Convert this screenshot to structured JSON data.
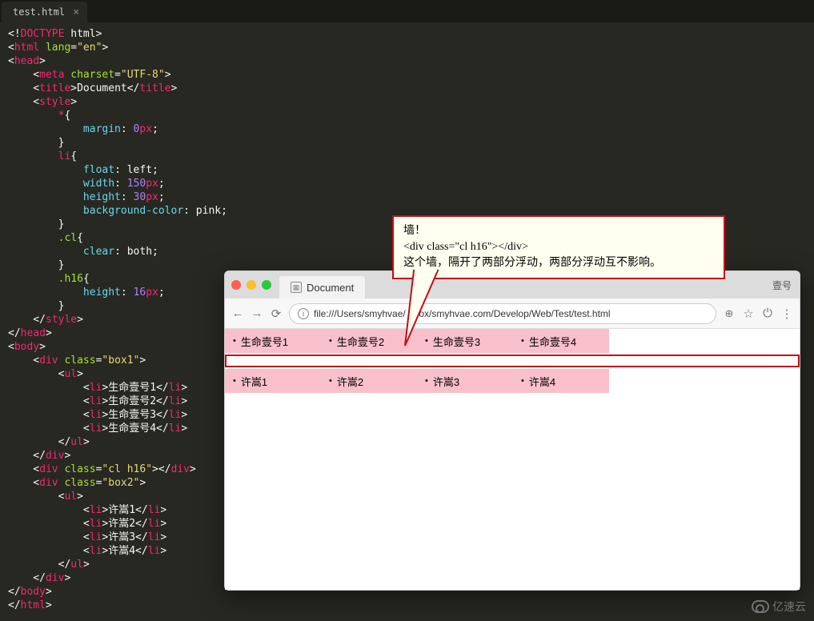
{
  "editor": {
    "tab_name": "test.html",
    "code_lines": [
      [
        {
          "c": "p",
          "t": "<!"
        },
        {
          "c": "r",
          "t": "DOCTYPE"
        },
        {
          "c": "p",
          "t": " html>"
        }
      ],
      [
        {
          "c": "p",
          "t": "<"
        },
        {
          "c": "r",
          "t": "html"
        },
        {
          "c": "p",
          "t": " "
        },
        {
          "c": "sel",
          "t": "lang"
        },
        {
          "c": "p",
          "t": "="
        },
        {
          "c": "y",
          "t": "\"en\""
        },
        {
          "c": "p",
          "t": ">"
        }
      ],
      [
        {
          "c": "p",
          "t": "<"
        },
        {
          "c": "r",
          "t": "head"
        },
        {
          "c": "p",
          "t": ">"
        }
      ],
      [
        {
          "c": "p",
          "t": "    <"
        },
        {
          "c": "r",
          "t": "meta"
        },
        {
          "c": "p",
          "t": " "
        },
        {
          "c": "sel",
          "t": "charset"
        },
        {
          "c": "p",
          "t": "="
        },
        {
          "c": "y",
          "t": "\"UTF-8\""
        },
        {
          "c": "p",
          "t": ">"
        }
      ],
      [
        {
          "c": "p",
          "t": "    <"
        },
        {
          "c": "r",
          "t": "title"
        },
        {
          "c": "p",
          "t": ">Document</"
        },
        {
          "c": "r",
          "t": "title"
        },
        {
          "c": "p",
          "t": ">"
        }
      ],
      [
        {
          "c": "p",
          "t": "    <"
        },
        {
          "c": "r",
          "t": "style"
        },
        {
          "c": "p",
          "t": ">"
        }
      ],
      [
        {
          "c": "p",
          "t": "        "
        },
        {
          "c": "r",
          "t": "*"
        },
        {
          "c": "p",
          "t": "{"
        }
      ],
      [
        {
          "c": "p",
          "t": "            "
        },
        {
          "c": "b",
          "t": "margin"
        },
        {
          "c": "p",
          "t": ": "
        },
        {
          "c": "pu",
          "t": "0"
        },
        {
          "c": "r",
          "t": "px"
        },
        {
          "c": "p",
          "t": ";"
        }
      ],
      [
        {
          "c": "p",
          "t": "        }"
        }
      ],
      [
        {
          "c": "p",
          "t": "        "
        },
        {
          "c": "r",
          "t": "li"
        },
        {
          "c": "p",
          "t": "{"
        }
      ],
      [
        {
          "c": "p",
          "t": "            "
        },
        {
          "c": "b",
          "t": "float"
        },
        {
          "c": "p",
          "t": ": left;"
        }
      ],
      [
        {
          "c": "p",
          "t": "            "
        },
        {
          "c": "b",
          "t": "width"
        },
        {
          "c": "p",
          "t": ": "
        },
        {
          "c": "pu",
          "t": "150"
        },
        {
          "c": "r",
          "t": "px"
        },
        {
          "c": "p",
          "t": ";"
        }
      ],
      [
        {
          "c": "p",
          "t": "            "
        },
        {
          "c": "b",
          "t": "height"
        },
        {
          "c": "p",
          "t": ": "
        },
        {
          "c": "pu",
          "t": "30"
        },
        {
          "c": "r",
          "t": "px"
        },
        {
          "c": "p",
          "t": ";"
        }
      ],
      [
        {
          "c": "p",
          "t": "            "
        },
        {
          "c": "b",
          "t": "background-color"
        },
        {
          "c": "p",
          "t": ": pink;"
        }
      ],
      [
        {
          "c": "p",
          "t": "        }"
        }
      ],
      [
        {
          "c": "p",
          "t": "        "
        },
        {
          "c": "sel",
          "t": ".cl"
        },
        {
          "c": "p",
          "t": "{"
        }
      ],
      [
        {
          "c": "p",
          "t": "            "
        },
        {
          "c": "b",
          "t": "clear"
        },
        {
          "c": "p",
          "t": ": both;"
        }
      ],
      [
        {
          "c": "p",
          "t": "        }"
        }
      ],
      [
        {
          "c": "p",
          "t": "        "
        },
        {
          "c": "sel",
          "t": ".h16"
        },
        {
          "c": "p",
          "t": "{"
        }
      ],
      [
        {
          "c": "p",
          "t": "            "
        },
        {
          "c": "b",
          "t": "height"
        },
        {
          "c": "p",
          "t": ": "
        },
        {
          "c": "pu",
          "t": "16"
        },
        {
          "c": "r",
          "t": "px"
        },
        {
          "c": "p",
          "t": ";"
        }
      ],
      [
        {
          "c": "p",
          "t": "        }"
        }
      ],
      [
        {
          "c": "p",
          "t": "    </"
        },
        {
          "c": "r",
          "t": "style"
        },
        {
          "c": "p",
          "t": ">"
        }
      ],
      [
        {
          "c": "p",
          "t": "</"
        },
        {
          "c": "r",
          "t": "head"
        },
        {
          "c": "p",
          "t": ">"
        }
      ],
      [
        {
          "c": "p",
          "t": "<"
        },
        {
          "c": "r",
          "t": "body"
        },
        {
          "c": "p",
          "t": ">"
        }
      ],
      [
        {
          "c": "p",
          "t": "    <"
        },
        {
          "c": "r",
          "t": "div"
        },
        {
          "c": "p",
          "t": " "
        },
        {
          "c": "sel",
          "t": "class"
        },
        {
          "c": "p",
          "t": "="
        },
        {
          "c": "y",
          "t": "\"box1\""
        },
        {
          "c": "p",
          "t": ">"
        }
      ],
      [
        {
          "c": "p",
          "t": "        <"
        },
        {
          "c": "r",
          "t": "ul"
        },
        {
          "c": "p",
          "t": ">"
        }
      ],
      [
        {
          "c": "p",
          "t": "            <"
        },
        {
          "c": "r",
          "t": "li"
        },
        {
          "c": "p",
          "t": ">生命壹号1</"
        },
        {
          "c": "r",
          "t": "li"
        },
        {
          "c": "p",
          "t": ">"
        }
      ],
      [
        {
          "c": "p",
          "t": "            <"
        },
        {
          "c": "r",
          "t": "li"
        },
        {
          "c": "p",
          "t": ">生命壹号2</"
        },
        {
          "c": "r",
          "t": "li"
        },
        {
          "c": "p",
          "t": ">"
        }
      ],
      [
        {
          "c": "p",
          "t": "            <"
        },
        {
          "c": "r",
          "t": "li"
        },
        {
          "c": "p",
          "t": ">生命壹号3</"
        },
        {
          "c": "r",
          "t": "li"
        },
        {
          "c": "p",
          "t": ">"
        }
      ],
      [
        {
          "c": "p",
          "t": "            <"
        },
        {
          "c": "r",
          "t": "li"
        },
        {
          "c": "p",
          "t": ">生命壹号4</"
        },
        {
          "c": "r",
          "t": "li"
        },
        {
          "c": "p",
          "t": ">"
        }
      ],
      [
        {
          "c": "p",
          "t": "        </"
        },
        {
          "c": "r",
          "t": "ul"
        },
        {
          "c": "p",
          "t": ">"
        }
      ],
      [
        {
          "c": "p",
          "t": "    </"
        },
        {
          "c": "r",
          "t": "div"
        },
        {
          "c": "p",
          "t": ">"
        }
      ],
      [
        {
          "c": "p",
          "t": "    <"
        },
        {
          "c": "r",
          "t": "div"
        },
        {
          "c": "p",
          "t": " "
        },
        {
          "c": "sel",
          "t": "class"
        },
        {
          "c": "p",
          "t": "="
        },
        {
          "c": "y",
          "t": "\"cl h16\""
        },
        {
          "c": "p",
          "t": "></"
        },
        {
          "c": "r",
          "t": "div"
        },
        {
          "c": "p",
          "t": ">"
        }
      ],
      [
        {
          "c": "p",
          "t": "    <"
        },
        {
          "c": "r",
          "t": "div"
        },
        {
          "c": "p",
          "t": " "
        },
        {
          "c": "sel",
          "t": "class"
        },
        {
          "c": "p",
          "t": "="
        },
        {
          "c": "y",
          "t": "\"box2\""
        },
        {
          "c": "p",
          "t": ">"
        }
      ],
      [
        {
          "c": "p",
          "t": "        <"
        },
        {
          "c": "r",
          "t": "ul"
        },
        {
          "c": "p",
          "t": ">"
        }
      ],
      [
        {
          "c": "p",
          "t": "            <"
        },
        {
          "c": "r",
          "t": "li"
        },
        {
          "c": "p",
          "t": ">许嵩1</"
        },
        {
          "c": "r",
          "t": "li"
        },
        {
          "c": "p",
          "t": ">"
        }
      ],
      [
        {
          "c": "p",
          "t": "            <"
        },
        {
          "c": "r",
          "t": "li"
        },
        {
          "c": "p",
          "t": ">许嵩2</"
        },
        {
          "c": "r",
          "t": "li"
        },
        {
          "c": "p",
          "t": ">"
        }
      ],
      [
        {
          "c": "p",
          "t": "            <"
        },
        {
          "c": "r",
          "t": "li"
        },
        {
          "c": "p",
          "t": ">许嵩3</"
        },
        {
          "c": "r",
          "t": "li"
        },
        {
          "c": "p",
          "t": ">"
        }
      ],
      [
        {
          "c": "p",
          "t": "            <"
        },
        {
          "c": "r",
          "t": "li"
        },
        {
          "c": "p",
          "t": ">许嵩4</"
        },
        {
          "c": "r",
          "t": "li"
        },
        {
          "c": "p",
          "t": ">"
        }
      ],
      [
        {
          "c": "p",
          "t": "        </"
        },
        {
          "c": "r",
          "t": "ul"
        },
        {
          "c": "p",
          "t": ">"
        }
      ],
      [
        {
          "c": "p",
          "t": "    </"
        },
        {
          "c": "r",
          "t": "div"
        },
        {
          "c": "p",
          "t": ">"
        }
      ],
      [
        {
          "c": "p",
          "t": "</"
        },
        {
          "c": "r",
          "t": "body"
        },
        {
          "c": "p",
          "t": ">"
        }
      ],
      [
        {
          "c": "p",
          "t": "</"
        },
        {
          "c": "r",
          "t": "html"
        },
        {
          "c": "p",
          "t": ">"
        }
      ]
    ]
  },
  "callout": {
    "line1": "墙！",
    "line2": "<div class=\"cl h16\"></div>",
    "line3": "这个墙，隔开了两部分浮动，两部分浮动互不影响。"
  },
  "browser": {
    "tab_title": "Document",
    "account_label": "壹号",
    "url": "file:///Users/smyhvae/      pbox/smyhvae.com/Develop/Web/Test/test.html",
    "row1": [
      "生命壹号1",
      "生命壹号2",
      "生命壹号3",
      "生命壹号4"
    ],
    "row2": [
      "许嵩1",
      "许嵩2",
      "许嵩3",
      "许嵩4"
    ]
  },
  "watermark": "亿速云"
}
